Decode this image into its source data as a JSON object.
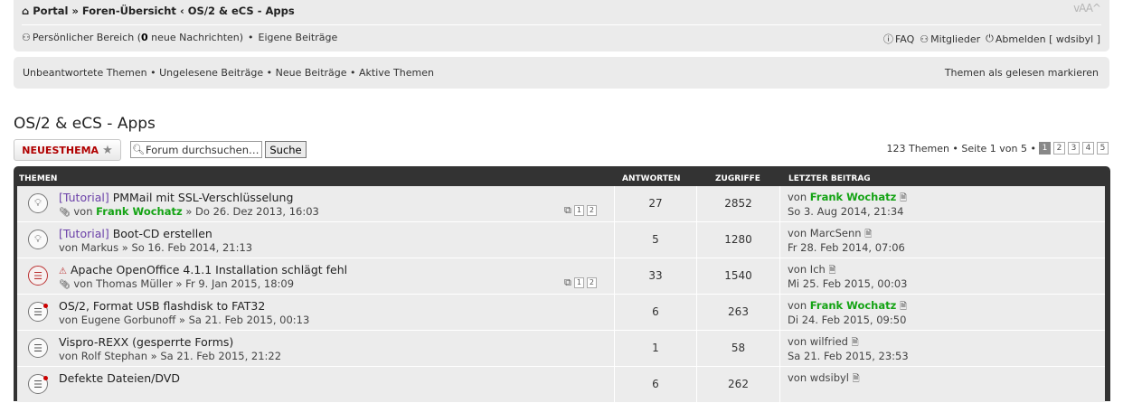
{
  "nav": {
    "crumbs": [
      "Portal",
      "Foren-Übersicht",
      "OS/2 & eCS - Apps"
    ],
    "sep1": "»",
    "sep2": "‹",
    "fontsize": "vAA^",
    "user_area": "Persönlicher Bereich (",
    "unread_count": "0",
    "unread_suffix": " neue Nachrichten)",
    "bullet": "•",
    "own_posts": "Eigene Beiträge",
    "faq": "FAQ",
    "members": "Mitglieder",
    "logout": "Abmelden [ wdsibyl ]"
  },
  "quick": {
    "links": "Unbeantwortete Themen • Ungelesene Beiträge • Neue Beiträge • Aktive Themen",
    "mark_read": "Themen als gelesen markieren"
  },
  "forum_title": "OS/2 & eCS - Apps",
  "actions": {
    "new_topic_part1": "NEUES",
    "new_topic_part2": "THEMA",
    "search_placeholder": "Forum durchsuchen…",
    "search_value": "Forum durchsuchen…",
    "search_button": "Suche"
  },
  "pagination": {
    "summary": "123 Themen • Seite 1 von 5 •",
    "pages": [
      "1",
      "2",
      "3",
      "4",
      "5"
    ],
    "current": "1"
  },
  "table": {
    "headers": {
      "topics": "THEMEN",
      "answers": "ANTWORTEN",
      "views": "ZUGRIFFE",
      "last_post": "LETZTER BEITRAG"
    },
    "rows": [
      {
        "prefix": "[Tutorial]",
        "title": "PMMail mit SSL-Verschlüsselung",
        "by": "von",
        "author": "Frank Wochatz",
        "date": "» Do 26. Dez 2013, 16:03",
        "answers": "27",
        "views": "2852",
        "last_by": "von",
        "last_author": "Frank Wochatz",
        "last_date": "So 3. Aug 2014, 21:34",
        "pages": [
          "1",
          "2"
        ]
      },
      {
        "prefix": "[Tutorial]",
        "title": "Boot-CD erstellen",
        "by": "von",
        "author": "Markus",
        "date": "» So 16. Feb 2014, 21:13",
        "answers": "5",
        "views": "1280",
        "last_by": "von",
        "last_author": "MarcSenn",
        "last_date": "Fr 28. Feb 2014, 07:06"
      },
      {
        "prefix": "",
        "title": "Apache OpenOffice 4.1.1 Installation schlägt fehl",
        "by": "von",
        "author": "Thomas Müller",
        "date": "» Fr 9. Jan 2015, 18:09",
        "answers": "33",
        "views": "1540",
        "last_by": "von",
        "last_author": "Ich",
        "last_date": "Mi 25. Feb 2015, 00:03",
        "pages": [
          "1",
          "2"
        ]
      },
      {
        "prefix": "",
        "title": "OS/2, Format USB flashdisk to FAT32",
        "by": "von",
        "author": "Eugene Gorbunoff",
        "date": "» Sa 21. Feb 2015, 00:13",
        "answers": "6",
        "views": "263",
        "last_by": "von",
        "last_author": "Frank Wochatz",
        "last_date": "Di 24. Feb 2015, 09:50"
      },
      {
        "prefix": "",
        "title": "Vispro-REXX (gesperrte Forms)",
        "by": "von",
        "author": "Rolf Stephan",
        "date": "» Sa 21. Feb 2015, 21:22",
        "answers": "1",
        "views": "58",
        "last_by": "von",
        "last_author": "wilfried",
        "last_date": "Sa 21. Feb 2015, 23:53"
      },
      {
        "prefix": "",
        "title": "Defekte Dateien/DVD",
        "by": "",
        "author": "",
        "date": "",
        "answers": "6",
        "views": "262",
        "last_by": "von",
        "last_author": "wdsibyl",
        "last_date": ""
      }
    ]
  },
  "colors": {
    "panel": "#ebebeb",
    "header": "#333333",
    "row": "#ececec",
    "accent_red": "#b00000",
    "author_green": "#14a314",
    "prefix_purple": "#6a3fa8"
  }
}
